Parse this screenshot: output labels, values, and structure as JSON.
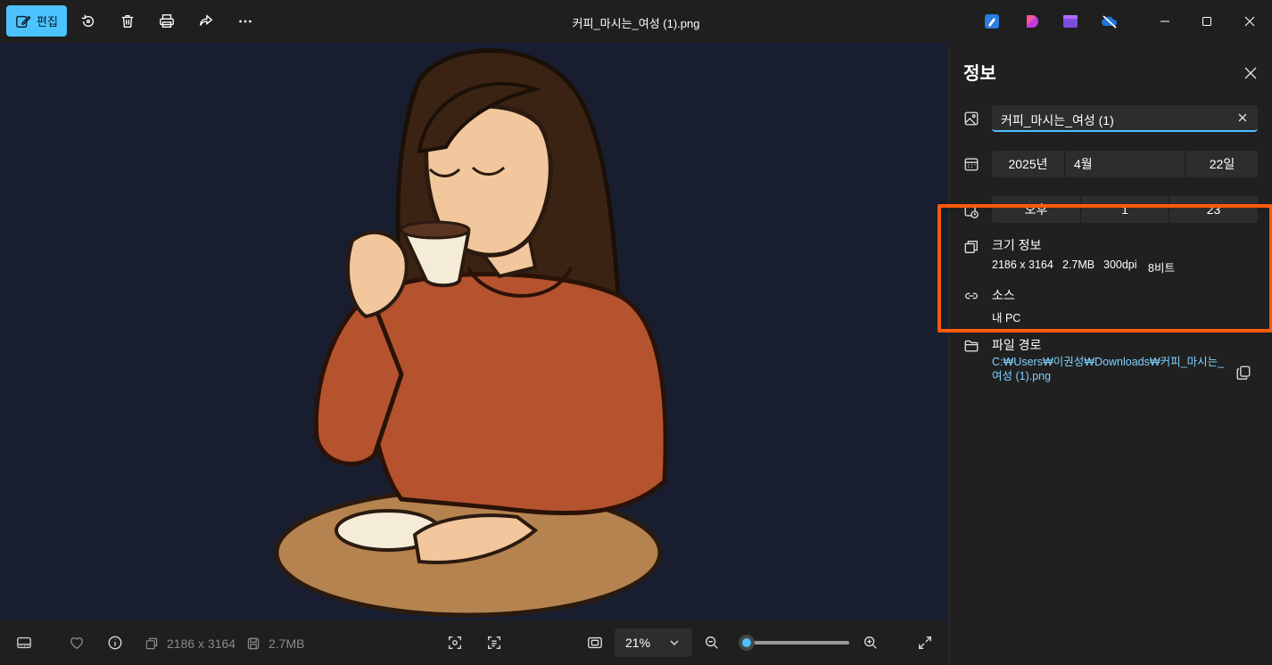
{
  "window": {
    "title": "커피_마시는_여성 (1).png"
  },
  "toolbar": {
    "edit_label": "편집",
    "icons": [
      "pen-edit-icon",
      "rotate-icon",
      "trash-icon",
      "print-icon",
      "share-icon",
      "more-icon"
    ]
  },
  "bottom_bar": {
    "dimensions": "2186 x 3164",
    "file_size": "2.7MB",
    "zoom": "21%",
    "zoom_level": 0.05
  },
  "info_panel": {
    "title": "정보",
    "file_name": "커피_마시는_여성 (1)",
    "date": {
      "year": "2025년",
      "month": "4월",
      "day": "22일"
    },
    "time": {
      "period": "오후",
      "hour": "1",
      "minute": "23"
    },
    "size_info_label": "크기 정보",
    "size_info": {
      "dimensions": "2186 x 3164",
      "size": "2.7MB",
      "dpi": "300dpi",
      "bits": "8비트"
    },
    "source_label": "소스",
    "source_value": "내 PC",
    "path_label": "파일 경로",
    "path_line1": "C:₩Users₩이권성₩Downloads₩커피_마시는_",
    "path_line2": "여성 (1).png"
  },
  "colors": {
    "accent": "#4cc2ff",
    "highlight": "#ff5a0a",
    "sweater": "#b5532e",
    "background": "#181e30"
  }
}
